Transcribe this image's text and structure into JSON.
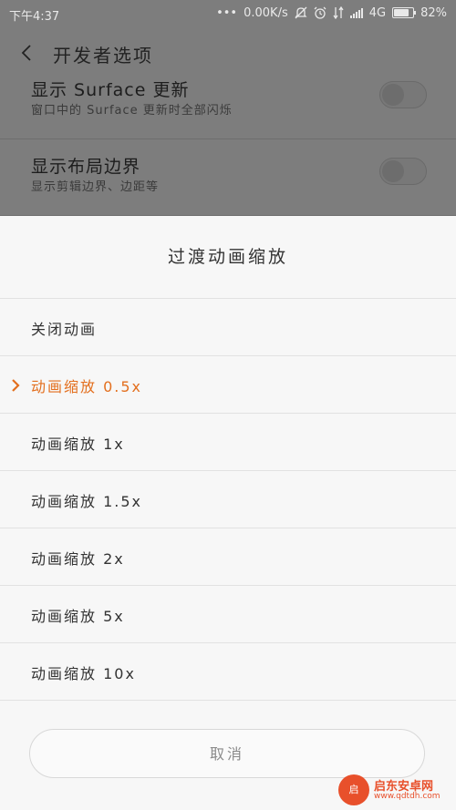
{
  "status_bar": {
    "time": "下午4:37",
    "dots": "•••",
    "net_speed": "0.00K/s",
    "network_type": "4G",
    "battery_percent": "82%",
    "battery_level": 0.82,
    "icons": [
      "mute-icon",
      "alarm-icon",
      "data-icon",
      "signal-icon",
      "battery-icon"
    ]
  },
  "header": {
    "title": "开发者选项",
    "back_icon": "chevron-left-icon"
  },
  "background_settings": [
    {
      "title": "显示 Surface 更新",
      "subtitle": "窗口中的 Surface 更新时全部闪烁",
      "toggle_on": false
    },
    {
      "title": "显示布局边界",
      "subtitle": "显示剪辑边界、边距等",
      "toggle_on": false
    }
  ],
  "dialog": {
    "title": "过渡动画缩放",
    "options": [
      {
        "label": "关闭动画",
        "selected": false
      },
      {
        "label": "动画缩放 0.5x",
        "selected": true
      },
      {
        "label": "动画缩放 1x",
        "selected": false
      },
      {
        "label": "动画缩放 1.5x",
        "selected": false
      },
      {
        "label": "动画缩放 2x",
        "selected": false
      },
      {
        "label": "动画缩放 5x",
        "selected": false
      },
      {
        "label": "动画缩放 10x",
        "selected": false
      }
    ],
    "cancel_label": "取消",
    "accent_color": "#e36f1e"
  },
  "watermark": {
    "logo_text": "启",
    "site_name": "启东安卓网",
    "url": "www.qdtdh.com"
  }
}
